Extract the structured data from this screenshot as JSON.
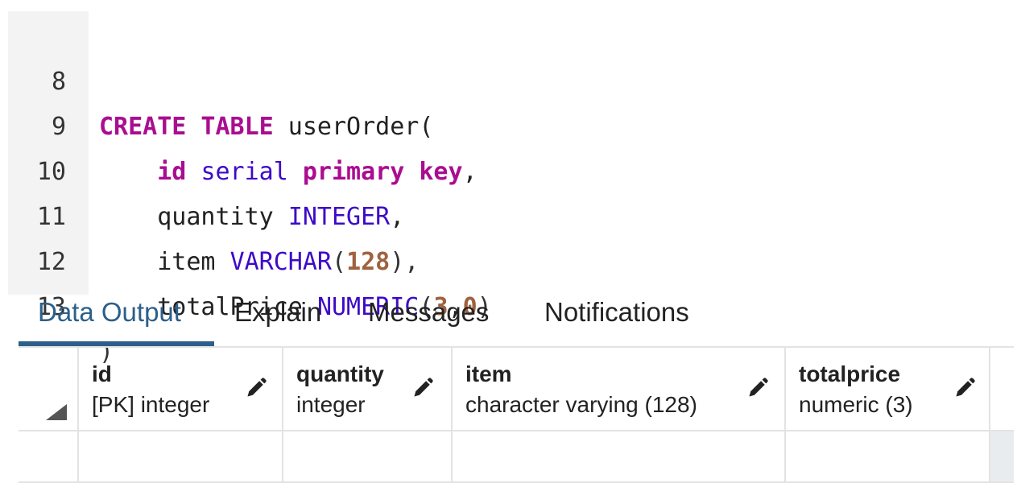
{
  "editor": {
    "lines": [
      {
        "number": "8",
        "tokens": [
          {
            "t": "CREATE TABLE",
            "c": "kw"
          },
          {
            "t": " userOrder(",
            "c": "plain"
          }
        ]
      },
      {
        "number": "9",
        "tokens": [
          {
            "t": "    ",
            "c": "plain"
          },
          {
            "t": "id",
            "c": "kw"
          },
          {
            "t": " ",
            "c": "plain"
          },
          {
            "t": "serial",
            "c": "type"
          },
          {
            "t": " ",
            "c": "plain"
          },
          {
            "t": "primary key",
            "c": "kw"
          },
          {
            "t": ",",
            "c": "plain"
          }
        ]
      },
      {
        "number": "10",
        "tokens": [
          {
            "t": "    quantity ",
            "c": "plain"
          },
          {
            "t": "INTEGER",
            "c": "type"
          },
          {
            "t": ",",
            "c": "plain"
          }
        ]
      },
      {
        "number": "11",
        "tokens": [
          {
            "t": "    item ",
            "c": "plain"
          },
          {
            "t": "VARCHAR",
            "c": "type"
          },
          {
            "t": "(",
            "c": "punct"
          },
          {
            "t": "128",
            "c": "num"
          },
          {
            "t": "),",
            "c": "punct"
          }
        ]
      },
      {
        "number": "12",
        "tokens": [
          {
            "t": "    totalPrice ",
            "c": "plain"
          },
          {
            "t": "NUMERIC",
            "c": "type"
          },
          {
            "t": "(",
            "c": "punct"
          },
          {
            "t": "3",
            "c": "num"
          },
          {
            "t": ",",
            "c": "plain"
          },
          {
            "t": "0",
            "c": "num"
          },
          {
            "t": ")",
            "c": "punct"
          }
        ]
      },
      {
        "number": "13",
        "tokens": [
          {
            "t": ")",
            "c": "punct"
          }
        ]
      }
    ]
  },
  "tabs": [
    {
      "label": "Data Output",
      "active": true
    },
    {
      "label": "Explain",
      "active": false
    },
    {
      "label": "Messages",
      "active": false
    },
    {
      "label": "Notifications",
      "active": false
    }
  ],
  "grid": {
    "columns": [
      {
        "name": "id",
        "type": "[PK] integer",
        "icon": "pencil-icon"
      },
      {
        "name": "quantity",
        "type": "integer",
        "icon": "pencil-icon"
      },
      {
        "name": "item",
        "type": "character varying (128)",
        "icon": "pencil-icon"
      },
      {
        "name": "totalprice",
        "type": "numeric (3)",
        "icon": "pencil-icon"
      }
    ],
    "corner_icon": "select-all-triangle-icon"
  },
  "colors": {
    "keyword": "#aa0d91",
    "type": "#3d0ac8",
    "number": "#a0623f",
    "accent": "#2c5f8a",
    "gutter": "#f3f3f3"
  }
}
